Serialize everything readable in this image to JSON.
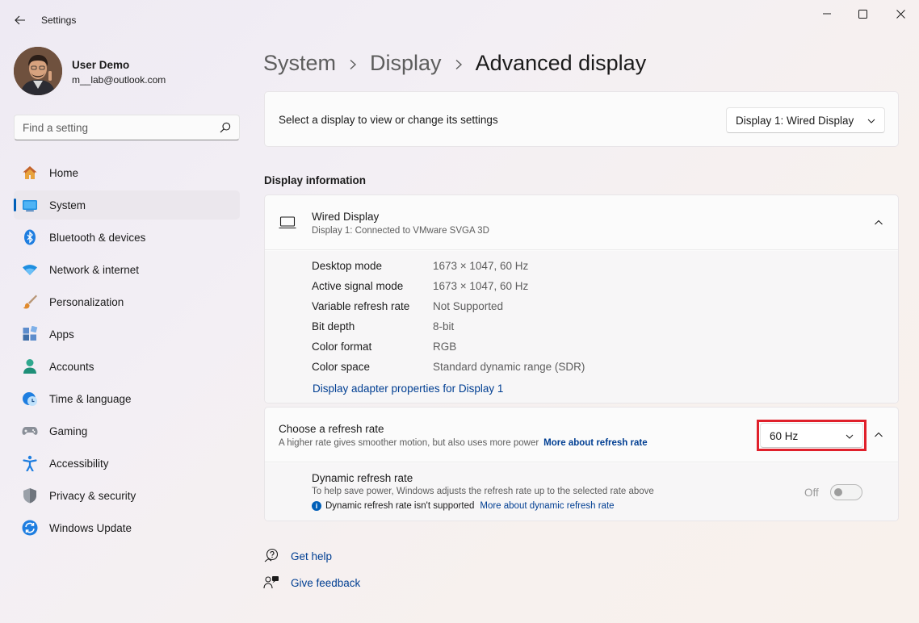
{
  "window": {
    "title": "Settings",
    "icons": {
      "back": "back-arrow-icon",
      "minimize": "minimize-icon",
      "maximize": "maximize-icon",
      "close": "close-icon"
    }
  },
  "profile": {
    "name": "User Demo",
    "email": "m__lab@outlook.com"
  },
  "search": {
    "placeholder": "Find a setting"
  },
  "sidebar": {
    "items": [
      {
        "label": "Home",
        "icon": "home-icon"
      },
      {
        "label": "System",
        "icon": "system-icon",
        "active": true
      },
      {
        "label": "Bluetooth & devices",
        "icon": "bluetooth-icon"
      },
      {
        "label": "Network & internet",
        "icon": "network-icon"
      },
      {
        "label": "Personalization",
        "icon": "brush-icon"
      },
      {
        "label": "Apps",
        "icon": "apps-icon"
      },
      {
        "label": "Accounts",
        "icon": "accounts-icon"
      },
      {
        "label": "Time & language",
        "icon": "clock-globe-icon"
      },
      {
        "label": "Gaming",
        "icon": "gamepad-icon"
      },
      {
        "label": "Accessibility",
        "icon": "accessibility-icon"
      },
      {
        "label": "Privacy & security",
        "icon": "shield-icon"
      },
      {
        "label": "Windows Update",
        "icon": "update-icon"
      }
    ]
  },
  "breadcrumb": {
    "items": [
      "System",
      "Display",
      "Advanced display"
    ]
  },
  "display_select": {
    "label": "Select a display to view or change its settings",
    "selected": "Display 1: Wired Display"
  },
  "display_info": {
    "section_title": "Display information",
    "title": "Wired Display",
    "subtitle": "Display 1: Connected to VMware SVGA 3D",
    "specs": [
      {
        "name": "Desktop mode",
        "value": "1673 × 1047, 60 Hz"
      },
      {
        "name": "Active signal mode",
        "value": "1673 × 1047, 60 Hz"
      },
      {
        "name": "Variable refresh rate",
        "value": "Not Supported"
      },
      {
        "name": "Bit depth",
        "value": "8-bit"
      },
      {
        "name": "Color format",
        "value": "RGB"
      },
      {
        "name": "Color space",
        "value": "Standard dynamic range (SDR)"
      }
    ],
    "adapter_link": "Display adapter properties for Display 1"
  },
  "refresh": {
    "title": "Choose a refresh rate",
    "subtitle": "A higher rate gives smoother motion, but also uses more power",
    "more_link": "More about refresh rate",
    "selected": "60 Hz",
    "highlight_color": "#e0202b",
    "dynamic": {
      "title": "Dynamic refresh rate",
      "subtitle": "To help save power, Windows adjusts the refresh rate up to the selected rate above",
      "note": "Dynamic refresh rate isn't supported",
      "note_link": "More about dynamic refresh rate",
      "toggle_state": "Off",
      "enabled": false
    }
  },
  "help": {
    "get_help": "Get help",
    "give_feedback": "Give feedback"
  },
  "colors": {
    "accent": "#005fb8",
    "link": "#003e92"
  }
}
